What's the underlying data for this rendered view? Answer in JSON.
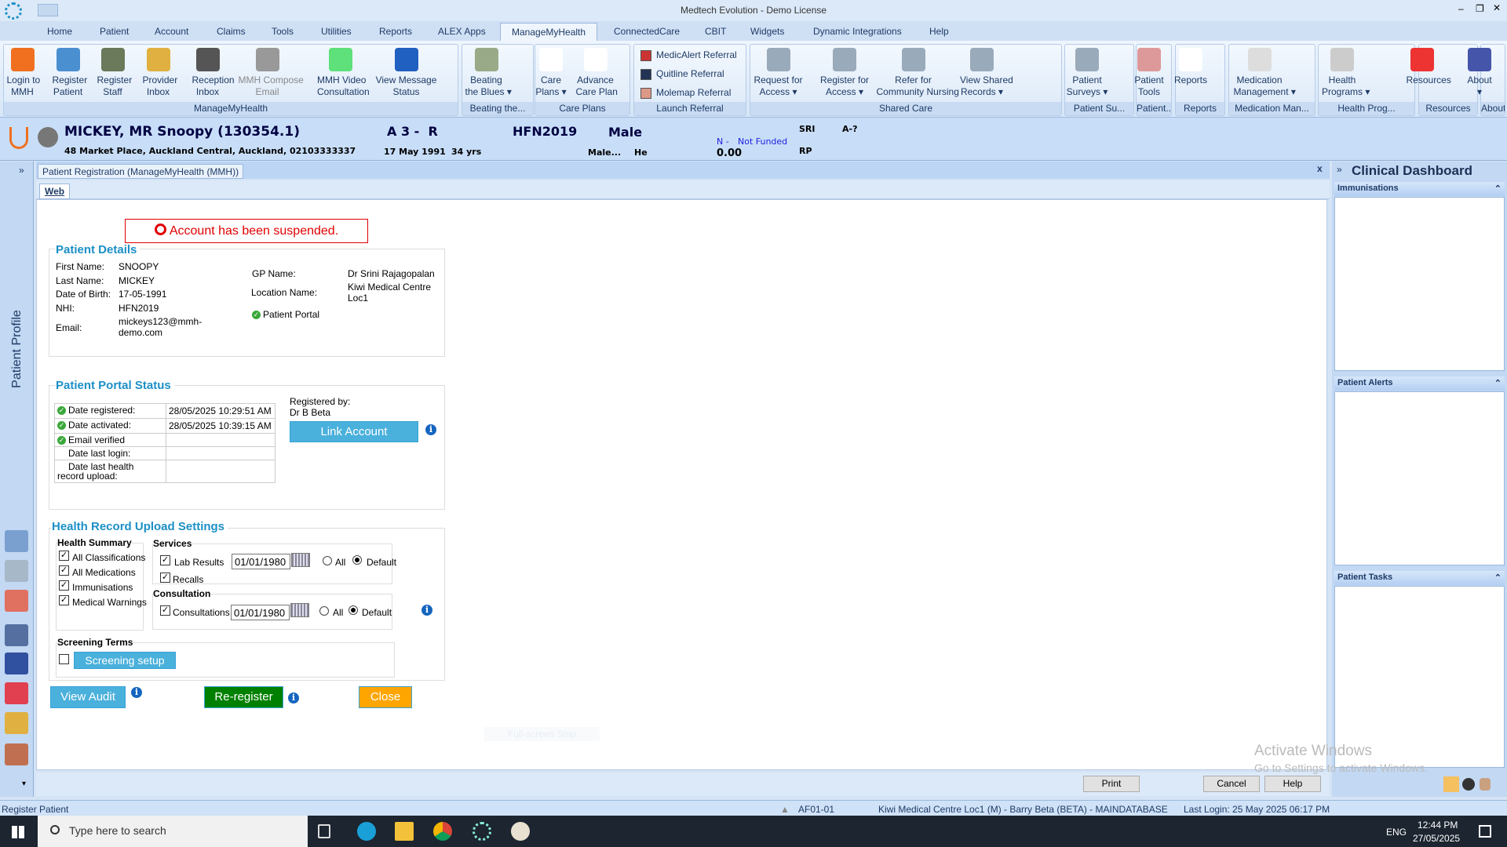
{
  "window": {
    "title": "Medtech Evolution - Demo License"
  },
  "menu": [
    "Home",
    "Patient",
    "Account",
    "Claims",
    "Tools",
    "Utilities",
    "Reports",
    "ALEX Apps",
    "ManageMyHealth",
    "ConnectedCare",
    "CBIT",
    "Widgets",
    "Dynamic Integrations",
    "Help"
  ],
  "menu_active": "ManageMyHealth",
  "ribbon": {
    "groups": [
      {
        "label": "ManageMyHealth",
        "buttons": [
          "Login to\nMMH",
          "Register\nPatient",
          "Register\nStaff",
          "Provider\nInbox",
          "Reception\nInbox",
          "MMH Compose\nEmail",
          "MMH Video\nConsultation",
          "View Message\nStatus"
        ]
      },
      {
        "label": "Beating the...",
        "buttons": [
          "Beating\nthe Blues ▾"
        ]
      },
      {
        "label": "Care Plans",
        "buttons": [
          "Care\nPlans ▾",
          "Advance\nCare Plan"
        ]
      },
      {
        "label": "Launch Referral",
        "buttons": [
          "MedicAlert Referral",
          "Quitline Referral",
          "Molemap Referral"
        ]
      },
      {
        "label": "Shared Care",
        "buttons": [
          "Request for\nAccess ▾",
          "Register for\nAccess ▾",
          "Refer for\nCommunity Nursing",
          "View Shared\nRecords ▾"
        ]
      },
      {
        "label": "Patient Su...",
        "buttons": [
          "Patient\nSurveys ▾"
        ]
      },
      {
        "label": "Patient...",
        "buttons": [
          "Patient\nTools"
        ]
      },
      {
        "label": "Reports",
        "buttons": [
          "Reports"
        ]
      },
      {
        "label": "Medication Man...",
        "buttons": [
          "Medication\nManagement ▾"
        ]
      },
      {
        "label": "Health Prog...",
        "buttons": [
          "Health\nPrograms ▾"
        ]
      },
      {
        "label": "Resources",
        "buttons": [
          "Resources"
        ]
      },
      {
        "label": "About",
        "buttons": [
          "About\n▾"
        ]
      }
    ]
  },
  "patient_header": {
    "name": "MICKEY, MR Snoopy (130354.1)",
    "address": "48 Market Place, Auckland Central, Auckland, 02103333337",
    "code": "A 3 -  R",
    "dob": "17 May 1991",
    "age": "34 yrs",
    "nhi": "HFN2019",
    "gender": "Male",
    "gender2": "Male...",
    "he": "He",
    "funding_code": "N -",
    "funding": "Not Funded",
    "balance": "0.00",
    "sri": "SRI",
    "a": "A-?",
    "rp": "RP"
  },
  "doc_tab": "Patient Registration (ManageMyHealth (MMH))",
  "sub_tab": "Web",
  "side_label": "Patient Profile",
  "alert": "Account has been suspended.",
  "patient_details": {
    "title": "Patient Details",
    "first_name_label": "First Name:",
    "first_name": "SNOOPY",
    "last_name_label": "Last Name:",
    "last_name": "MICKEY",
    "dob_label": "Date of Birth:",
    "dob": "17-05-1991",
    "nhi_label": "NHI:",
    "nhi": "HFN2019",
    "email_label": "Email:",
    "email": "mickeys123@mmh-\ndemo.com",
    "gp_label": "GP Name:",
    "gp": "Dr Srini Rajagopalan",
    "location_label": "Location Name:",
    "location": "Kiwi Medical Centre\nLoc1",
    "portal": "Patient Portal"
  },
  "portal_status": {
    "title": "Patient Portal Status",
    "rows": [
      {
        "label": "Date registered:",
        "value": "28/05/2025 10:29:51 AM",
        "ok": true
      },
      {
        "label": "Date activated:",
        "value": "28/05/2025 10:39:15 AM",
        "ok": true
      },
      {
        "label": "Email verified",
        "value": "",
        "ok": true
      },
      {
        "label": "Date last login:",
        "value": "",
        "ok": false
      },
      {
        "label": "Date last health\nrecord upload:",
        "value": "",
        "ok": false
      }
    ],
    "registered_by_label": "Registered by:",
    "registered_by": "Dr B Beta",
    "link_account": "Link Account"
  },
  "upload_settings": {
    "title": "Health Record Upload Settings",
    "health_summary": "Health Summary",
    "hs_items": [
      "All Classifications",
      "All Medications",
      "Immunisations",
      "Medical Warnings"
    ],
    "services": "Services",
    "lab_results": "Lab Results",
    "lab_date": "01/01/1980",
    "all": "All",
    "default": "Default",
    "recalls": "Recalls",
    "consultation": "Consultation",
    "consultations": "Consultations",
    "cons_date": "01/01/1980",
    "screening_terms": "Screening Terms",
    "screening_setup": "Screening setup"
  },
  "actions": {
    "view_audit": "View Audit",
    "reregister": "Re-register",
    "close": "Close",
    "ghost": "Full-screen Snip"
  },
  "footer": {
    "print": "Print",
    "cancel": "Cancel",
    "help": "Help"
  },
  "dashboard": {
    "title": "Clinical Dashboard",
    "panels": [
      "Immunisations",
      "Patient Alerts",
      "Patient Tasks"
    ]
  },
  "watermark": {
    "line1": "Activate Windows",
    "line2": "Go to Settings to activate Windows."
  },
  "status": {
    "left": "Register Patient",
    "code": "AF01-01",
    "location": "Kiwi Medical Centre Loc1 (M) - Barry Beta (BETA) - MAINDATABASE",
    "last_login": "Last Login: 25 May 2025 06:17 PM"
  },
  "taskbar": {
    "search_placeholder": "Type here to search",
    "lang": "ENG",
    "time": "12:44 PM",
    "date": "27/05/2025"
  },
  "colors": {
    "accent": "#1c8fc6",
    "alert": "#e00000",
    "link_btn": "#4ab0dc",
    "reregister": "#008000",
    "close": "#ffa500"
  }
}
